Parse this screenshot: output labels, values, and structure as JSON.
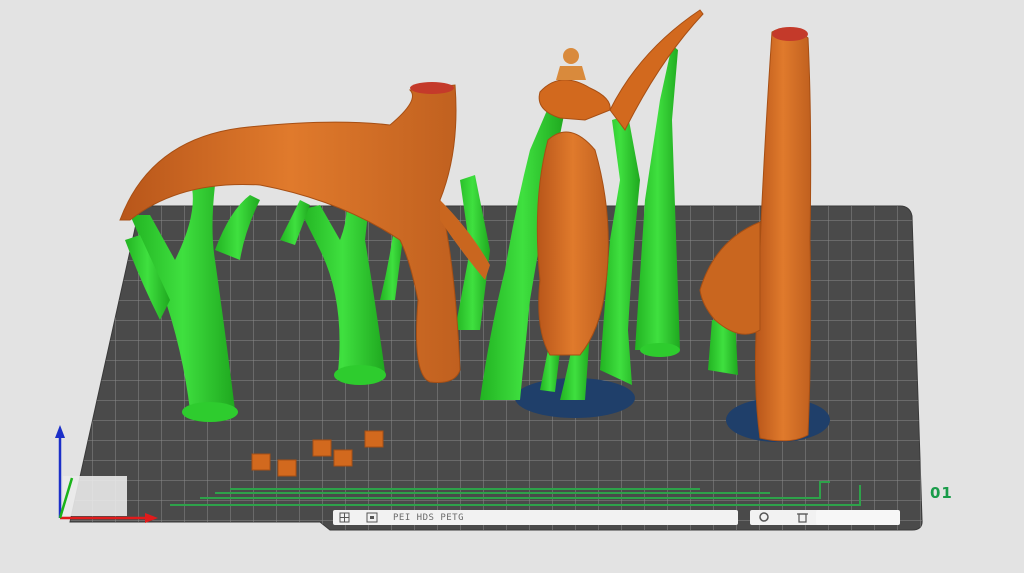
{
  "scene": {
    "background_color": "#e3e3e3",
    "model_color": "#d2691e",
    "support_color": "#2ecc2e",
    "bed_color": "#4a4a4a",
    "grid_color": "#b4b4b4",
    "brim_color": "#1f3f6a"
  },
  "build_plate": {
    "label": "PEI HDS PETG",
    "label_color": "#6a6a6a"
  },
  "plate_number": {
    "text": "01",
    "color": "#1a9c4a"
  },
  "axes": {
    "x_color": "#e01b1b",
    "y_color": "#1ab41a",
    "z_color": "#1b2fc8"
  },
  "toolbar_icons": [
    "grid-icon",
    "printer-icon",
    "settings-icon",
    "trash-icon"
  ]
}
